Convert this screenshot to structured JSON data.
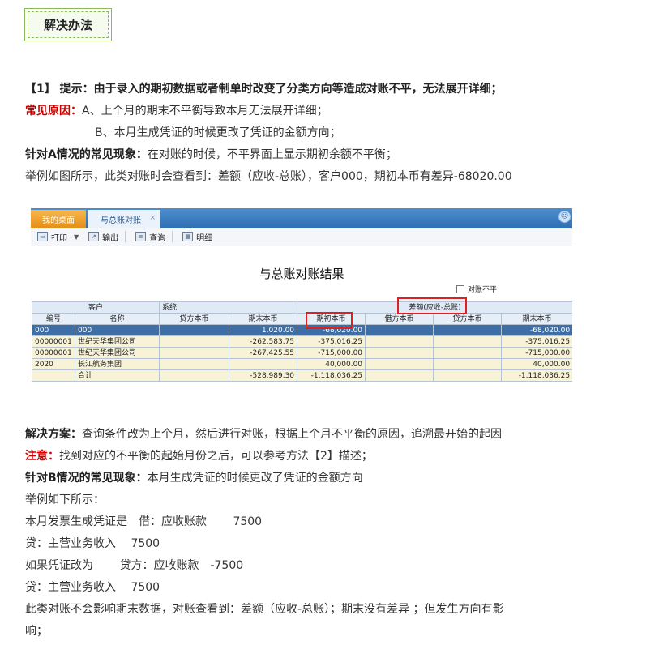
{
  "heading": "解决办法",
  "p1": "【1】 提示：由于录入的期初数据或者制单时改变了分类方向等造成对账不平，无法展开详细；",
  "p2_label": "常见原因：",
  "p2_text": "A、上个月的期末不平衡导致本月无法展开详细；",
  "p3_text": "B、本月生成凭证的时候更改了凭证的金额方向；",
  "p4_label": "针对A情况的常见现象：",
  "p4_text": "在对账的时候，不平界面上显示期初余额不平衡；",
  "p5_text": "举例如图所示，此类对账时会查看到：差额（应收-总账），客户000，期初本币有差异-68020.00",
  "shot": {
    "tab_home": "我的桌面",
    "tab_active": "与总账对账",
    "tab_close": "×",
    "smile": "☺",
    "toolbar": {
      "print": "打印",
      "print_dropdown": "▼",
      "export": "输出",
      "query": "查询",
      "detail": "明细"
    },
    "report_title": "与总账对账结果",
    "unbalanced_label": "对账不平",
    "table": {
      "group_customer": "客户",
      "group_system": "系统",
      "group_diff": "差额(应收-总账)",
      "columns": [
        "编号",
        "名称",
        "贷方本币",
        "期末本币",
        "期初本币",
        "借方本币",
        "贷方本币",
        "期末本币"
      ],
      "rows": [
        [
          "000",
          "000",
          "",
          "1,020.00",
          "-68,020.00",
          "",
          "",
          "-68,020.00"
        ],
        [
          "00000001",
          "世纪天华集团公司",
          "",
          "-262,583.75",
          "-375,016.25",
          "",
          "",
          "-375,016.25"
        ],
        [
          "00000001",
          "世纪天华集团公司",
          "",
          "-267,425.55",
          "-715,000.00",
          "",
          "",
          "-715,000.00"
        ],
        [
          "2020",
          "长江航务集团",
          "",
          "",
          "40,000.00",
          "",
          "",
          "40,000.00"
        ],
        [
          "",
          "合计",
          "",
          "-528,989.30",
          "-1,118,036.25",
          "",
          "",
          "-1,118,036.25"
        ]
      ]
    }
  },
  "p6_label": "解决方案：",
  "p6_text": "查询条件改为上个月，然后进行对账，根据上个月不平衡的原因，追溯最开始的起因",
  "p7_label": "注意：",
  "p7_text": "找到对应的不平衡的起始月份之后，可以参考方法【2】描述；",
  "p8_label": "针对B情况的常见现象：",
  "p8_text": "本月生成凭证的时候更改了凭证的金额方向",
  "p9_text": "举例如下所示：",
  "p10_text": "本月发票生成凭证是　借：应收账款　　 7500",
  "p11_text": "贷：主营业务收入　 7500",
  "p12_text": "如果凭证改为　　 贷方：应收账款　-7500",
  "p13_text": "贷：主营业务收入　 7500",
  "p14_text": "此类对账不会影响期末数据，对账查看到：差额（应收-总账）；期末没有差异 ；但发生方向有影",
  "p15_text": "响；"
}
